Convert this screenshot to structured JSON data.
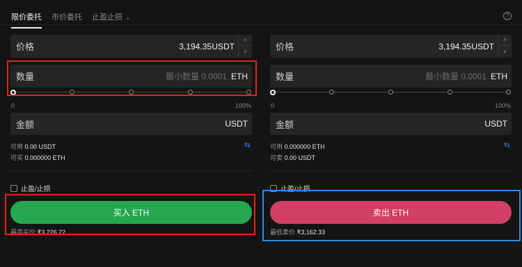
{
  "tabs": {
    "limit": "限价委托",
    "market": "市价委托",
    "tpsl": "止盈止损"
  },
  "help_icon": "?",
  "buy": {
    "price_label": "价格",
    "price_value": "3,194.35",
    "price_unit": "USDT",
    "qty_label": "数量",
    "qty_placeholder": "最小数量 0.0001",
    "qty_unit": "ETH",
    "slider_min": "0",
    "slider_max": "100%",
    "amount_label": "金额",
    "amount_unit": "USDT",
    "avail_label": "可用",
    "avail_value": "0.00 USDT",
    "can_label": "可买",
    "can_value": "0.000000 ETH",
    "tpsl_label": "止盈/止损",
    "button": "买入 ETH",
    "best_label": "最高买价",
    "best_value": "₹3,226.22"
  },
  "sell": {
    "price_label": "价格",
    "price_value": "3,194.35",
    "price_unit": "USDT",
    "qty_label": "数量",
    "qty_placeholder": "最小数量 0.0001",
    "qty_unit": "ETH",
    "slider_min": "0",
    "slider_max": "100%",
    "amount_label": "金额",
    "amount_unit": "USDT",
    "avail_label": "可用",
    "avail_value": "0.000000 ETH",
    "can_label": "可卖",
    "can_value": "0.00 USDT",
    "tpsl_label": "止盈/止损",
    "button": "卖出 ETH",
    "best_label": "最低卖价",
    "best_value": "₹3,162.33"
  },
  "colors": {
    "buy": "#25a750",
    "sell": "#d23f65",
    "highlight_red": "#e0251b",
    "highlight_blue": "#2f8ee0"
  }
}
